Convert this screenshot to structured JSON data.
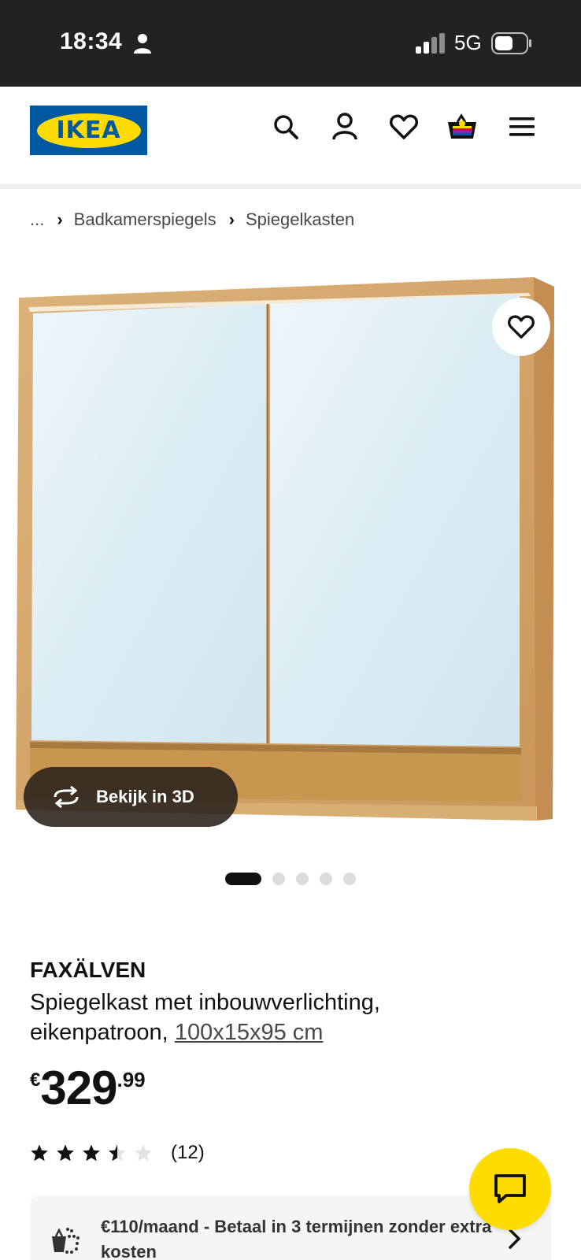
{
  "status_bar": {
    "time": "18:34",
    "network": "5G"
  },
  "header": {
    "logo_text": "IKEA",
    "icons": [
      "search-icon",
      "account-icon",
      "wishlist-icon",
      "cart-icon",
      "menu-icon"
    ]
  },
  "breadcrumb": {
    "ellipsis": "...",
    "items": [
      "Badkamerspiegels",
      "Spiegelkasten"
    ]
  },
  "gallery": {
    "view_3d_label": "Bekijk in 3D",
    "image_count": 5,
    "active_index": 0
  },
  "product": {
    "name": "FAXÄLVEN",
    "description": "Spiegelkast met inbouwverlichting, eikenpatroon,",
    "dimensions": "100x15x95 cm",
    "price": {
      "currency": "€",
      "integer": "329",
      "decimals": ".99"
    },
    "rating": {
      "value": 3.5,
      "max": 5,
      "count_label": "(12)"
    }
  },
  "payment_banner": {
    "text": "€110/maand - Betaal in 3 termijnen zonder extra kosten"
  },
  "colors": {
    "brand_blue": "#0058a3",
    "brand_yellow": "#ffdb00",
    "status_bar_bg": "#222222"
  }
}
